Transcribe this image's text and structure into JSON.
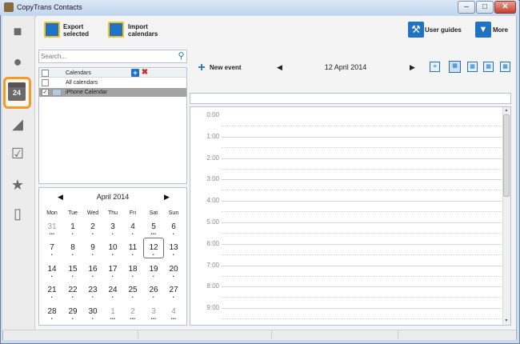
{
  "window": {
    "title": "CopyTrans Contacts"
  },
  "toolbar": {
    "export_label_1": "Export",
    "export_label_2": "selected",
    "import_label_1": "Import",
    "import_label_2": "calendars",
    "guides_label": "User guides",
    "more_label": "More"
  },
  "search": {
    "placeholder": "Search..."
  },
  "calendars": {
    "header": "Calendars",
    "items": [
      {
        "label": "All calendars",
        "checked": false
      },
      {
        "label": "iPhone Calendar",
        "checked": true
      }
    ]
  },
  "sidebar": {
    "calendar_badge": "24"
  },
  "mini_calendar": {
    "title": "April 2014",
    "weekdays": [
      "Mon",
      "Tue",
      "Wed",
      "Thu",
      "Fri",
      "Sat",
      "Sun"
    ],
    "weeks": [
      [
        "31",
        "1",
        "2",
        "3",
        "4",
        "5",
        "6"
      ],
      [
        "7",
        "8",
        "9",
        "10",
        "11",
        "12",
        "13"
      ],
      [
        "14",
        "15",
        "16",
        "17",
        "18",
        "19",
        "20"
      ],
      [
        "21",
        "22",
        "23",
        "24",
        "25",
        "26",
        "27"
      ],
      [
        "28",
        "29",
        "30",
        "1",
        "2",
        "3",
        "4"
      ]
    ]
  },
  "day_view": {
    "new_event_label": "New event",
    "date_title": "12 April 2014",
    "hours": [
      "0:00",
      "1:00",
      "2:00",
      "3:00",
      "4:00",
      "5:00",
      "6:00",
      "7:00",
      "8:00",
      "9:00"
    ]
  },
  "colors": {
    "accent": "#1f73c4",
    "selected_nav": "#f19b2c",
    "selected_row": "#a3a3a3"
  }
}
